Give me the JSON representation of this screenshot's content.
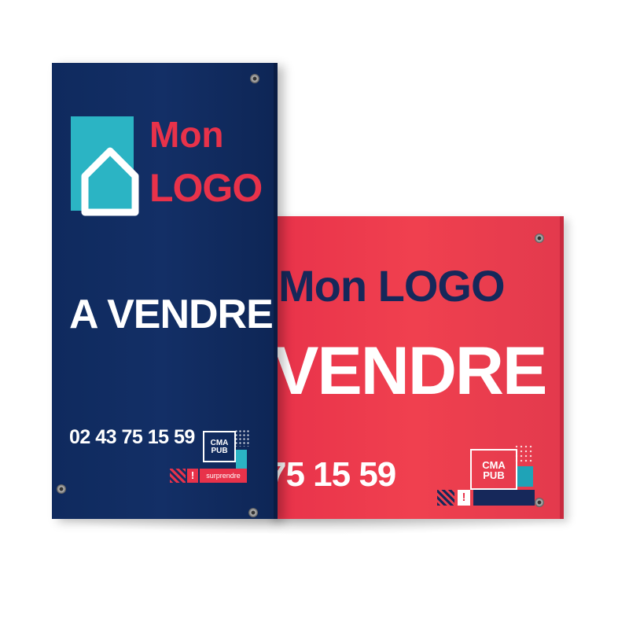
{
  "colors": {
    "navy": "#132f66",
    "red": "#e8324a",
    "teal": "#2bb4c4",
    "white": "#ffffff"
  },
  "blue_sign": {
    "logo_line1": "Mon",
    "logo_line2": "LOGO",
    "headline": "A VENDRE",
    "phone": "02 43 75 15 59",
    "badge_top": "CMA",
    "badge_bottom": "PUB",
    "tagline": "surprendre",
    "mark": "!",
    "icon": "house-icon"
  },
  "red_sign": {
    "logo": "Mon LOGO",
    "headline": "VENDRE",
    "phone": "75 15 59",
    "badge_top": "CMA",
    "badge_bottom": "PUB",
    "mark": "!"
  }
}
